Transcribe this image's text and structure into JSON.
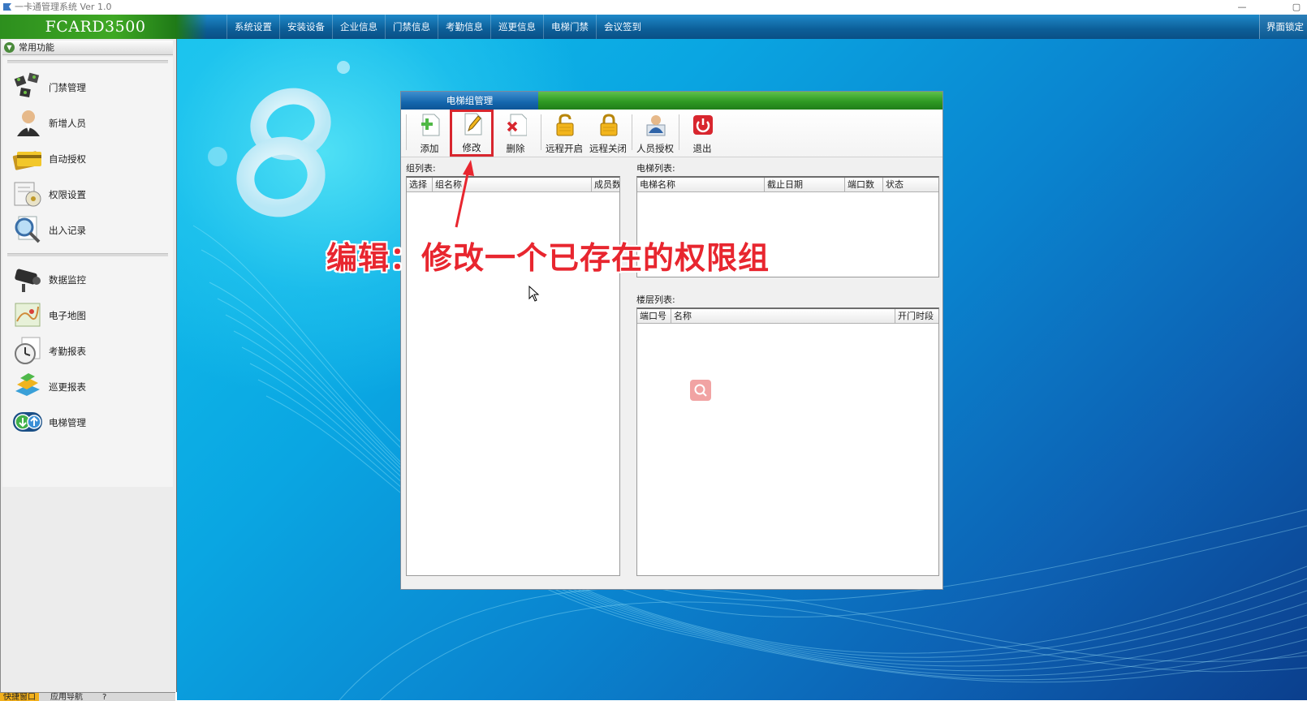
{
  "window": {
    "title": "一卡通管理系统  Ver 1.0",
    "min_glyph": "—",
    "max_glyph": "▢"
  },
  "menubar": {
    "brand": "FCARD3500",
    "items": [
      "系统设置",
      "安装设备",
      "企业信息",
      "门禁信息",
      "考勤信息",
      "巡更信息",
      "电梯门禁",
      "会议签到"
    ],
    "right_label": "界面锁定"
  },
  "sidebar": {
    "header": "常用功能",
    "items": [
      {
        "label": "门禁管理",
        "icon": "door-access-icon"
      },
      {
        "label": "新增人员",
        "icon": "person-icon"
      },
      {
        "label": "自动授权",
        "icon": "cards-icon"
      },
      {
        "label": "权限设置",
        "icon": "permission-icon"
      },
      {
        "label": "出入记录",
        "icon": "magnifier-record-icon"
      },
      {
        "label": "数据监控",
        "icon": "camera-icon"
      },
      {
        "label": "电子地图",
        "icon": "map-icon"
      },
      {
        "label": "考勤报表",
        "icon": "clock-report-icon"
      },
      {
        "label": "巡更报表",
        "icon": "patrol-report-icon"
      },
      {
        "label": "电梯管理",
        "icon": "elevator-icon"
      }
    ],
    "tabs": [
      "快捷窗口",
      "应用导航",
      "?"
    ]
  },
  "dialog": {
    "title": "电梯组管理",
    "toolbar": [
      {
        "label": "添加",
        "icon": "add-doc-icon"
      },
      {
        "label": "修改",
        "icon": "edit-pencil-icon"
      },
      {
        "label": "删除",
        "icon": "delete-x-icon"
      },
      {
        "label": "远程开启",
        "icon": "unlock-icon"
      },
      {
        "label": "远程关闭",
        "icon": "lock-icon"
      },
      {
        "label": "人员授权",
        "icon": "user-auth-icon"
      },
      {
        "label": "退出",
        "icon": "power-icon"
      }
    ],
    "group_list": {
      "label": "组列表:",
      "columns": [
        "选择",
        "组名称",
        "成员数"
      ]
    },
    "elevator_list": {
      "label": "电梯列表:",
      "columns": [
        "电梯名称",
        "截止日期",
        "端口数",
        "状态"
      ]
    },
    "floor_list": {
      "label": "楼层列表:",
      "columns": [
        "端口号",
        "名称",
        "开门时段"
      ]
    }
  },
  "annotation": {
    "text": "编辑：修改一个已存在的权限组",
    "color": "#e8262f"
  },
  "colors": {
    "menubar": "#0c5f99",
    "brand_green": "#3fa824",
    "dialog_tab": "#1467ad",
    "highlight": "#d8262e"
  }
}
